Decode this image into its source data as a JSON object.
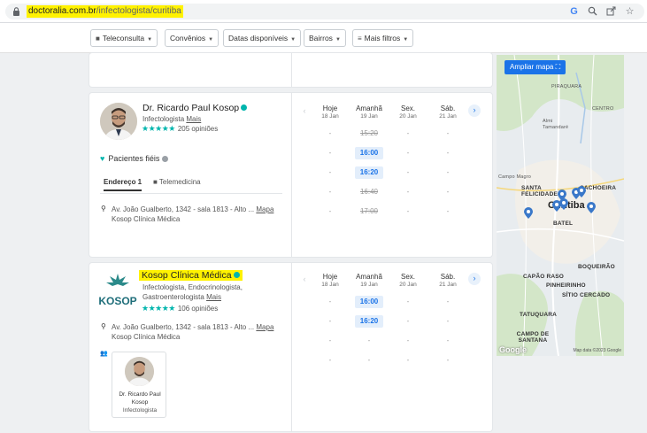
{
  "browser": {
    "url_domain": "doctoralia.com.br",
    "url_path": "/infectologista/curitiba",
    "icons": [
      "lock-icon",
      "google-icon",
      "zoom-icon",
      "share-icon",
      "bookmark-star-icon"
    ]
  },
  "filters": [
    {
      "label": "Teleconsulta"
    },
    {
      "label": "Convênios"
    },
    {
      "label": "Datas disponíveis"
    },
    {
      "label": "Bairros"
    },
    {
      "label": "Mais filtros"
    }
  ],
  "calendar_days": [
    {
      "name": "Hoje",
      "date": "18 Jan"
    },
    {
      "name": "Amanhã",
      "date": "19 Jan"
    },
    {
      "name": "Sex.",
      "date": "20 Jan"
    },
    {
      "name": "Sáb.",
      "date": "21 Jan"
    }
  ],
  "card1": {
    "name": "Dr. Ricardo Paul Kosop",
    "specialty": "Infectologista",
    "mais": "Mais",
    "stars": "★★★★★",
    "opinions": "205 opiniões",
    "pacientes_fieis": "Pacientes fiéis",
    "tab_address": "Endereço 1",
    "tab_tele": "Telemedicina",
    "address": "Av. João Gualberto, 1342 - sala 1813 - Alto ...",
    "mapa": "Mapa",
    "clinic": "Kosop Clínica Médica",
    "slots": {
      "hoje": [
        "-",
        "-",
        "-",
        "-",
        "-"
      ],
      "amanha": [
        "15:20",
        "16:00",
        "16:20",
        "16:40",
        "17:00"
      ],
      "sex": [
        "-",
        "-",
        "-",
        "-",
        "-"
      ],
      "sab": [
        "-",
        "-",
        "-",
        "-",
        "-"
      ]
    }
  },
  "card2": {
    "name": "Kosop Clínica Médica",
    "logo_text": "KOSOP",
    "specialty_line1": "Infectologista, Endocrinologista,",
    "specialty_line2": "Gastroenterologista",
    "mais": "Mais",
    "stars": "★★★★★",
    "opinions": "106 opiniões",
    "address": "Av. João Gualberto, 1342 - sala 1813 - Alto ...",
    "mapa": "Mapa",
    "clinic": "Kosop Clínica Médica",
    "mini_name_1": "Dr. Ricardo Paul",
    "mini_name_2": "Kosop",
    "mini_spec": "Infectologista",
    "slots": {
      "hoje": [
        "-",
        "-",
        "-",
        "-"
      ],
      "amanha": [
        "16:00",
        "16:20",
        "-",
        "-"
      ],
      "sex": [
        "-",
        "-",
        "-",
        "-"
      ],
      "sab": [
        "-",
        "-",
        "-",
        "-"
      ]
    }
  },
  "map": {
    "button": "Ampliar mapa",
    "labels": [
      "PIRAQUARA",
      "CENTRO",
      "Almi Tamandaré",
      "Campo Magro",
      "SANTA FELICIDADE",
      "CACHOEIRA",
      "BATEL",
      "BOQUEIRÃO",
      "CAPÃO RASO",
      "PINHEIRINHO",
      "SÍTIO CERCADO",
      "TATUQUARA",
      "CAMPO DE SANTANA"
    ],
    "city": "Curitiba",
    "google": "Google",
    "data_credit": "Map data ©2023 Google"
  }
}
